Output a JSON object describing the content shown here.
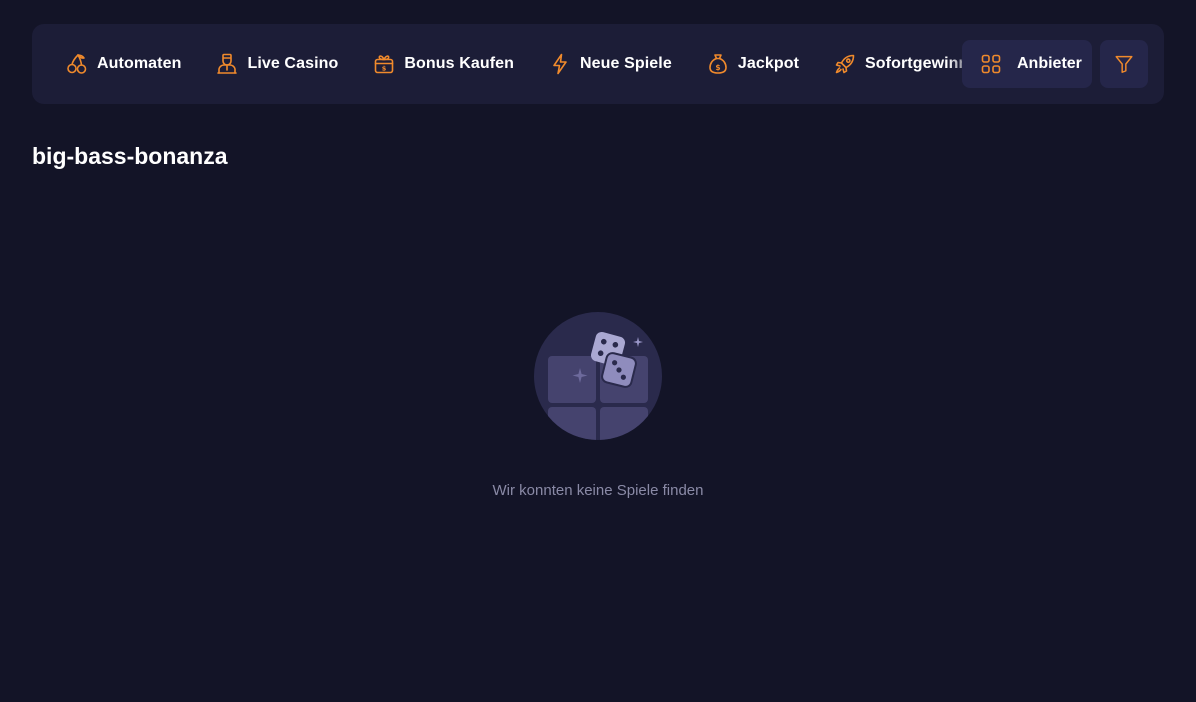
{
  "nav": {
    "categories": [
      {
        "label": "Automaten",
        "icon": "cherries-icon"
      },
      {
        "label": "Live Casino",
        "icon": "dealer-icon"
      },
      {
        "label": "Bonus Kaufen",
        "icon": "gift-icon"
      },
      {
        "label": "Neue Spiele",
        "icon": "lightning-icon"
      },
      {
        "label": "Jackpot",
        "icon": "money-bag-icon"
      },
      {
        "label": "Sofortgewinn",
        "icon": "rocket-icon"
      }
    ],
    "providers_label": "Anbieter",
    "filter_icon": "filter-icon"
  },
  "page": {
    "title": "big-bass-bonanza"
  },
  "empty_state": {
    "message": "Wir konnten keine Spiele finden",
    "icon": "dice-illustration"
  },
  "colors": {
    "background": "#131427",
    "panel": "#1c1d37",
    "button": "#25264a",
    "accent": "#f08a2c",
    "muted_text": "#8a8aa6"
  }
}
